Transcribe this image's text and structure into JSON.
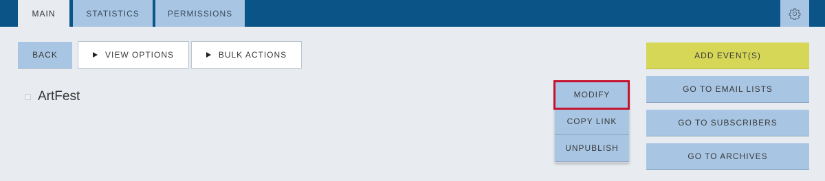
{
  "tabs": [
    {
      "label": "MAIN",
      "active": true
    },
    {
      "label": "STATISTICS",
      "active": false
    },
    {
      "label": "PERMISSIONS",
      "active": false
    }
  ],
  "toolbar": {
    "back_label": "BACK",
    "view_options_label": "VIEW OPTIONS",
    "bulk_actions_label": "BULK ACTIONS"
  },
  "item": {
    "title": "ArtFest"
  },
  "dropdown": {
    "items": [
      {
        "label": "MODIFY",
        "highlighted": true
      },
      {
        "label": "COPY LINK"
      },
      {
        "label": "UNPUBLISH"
      }
    ]
  },
  "side_actions": {
    "add_event_label": "ADD EVENT(S)",
    "email_lists_label": "GO TO EMAIL LISTS",
    "subscribers_label": "GO TO SUBSCRIBERS",
    "archives_label": "GO TO ARCHIVES"
  },
  "icons": {
    "settings": "gear-icon",
    "expand": "triangle-right-icon"
  },
  "colors": {
    "topbar": "#0b5488",
    "tab_inactive": "#a8c6e4",
    "background": "#e8ecf0",
    "button_blue": "#a8c6e4",
    "button_yellow": "#d6d757",
    "highlight": "#c4122e"
  }
}
